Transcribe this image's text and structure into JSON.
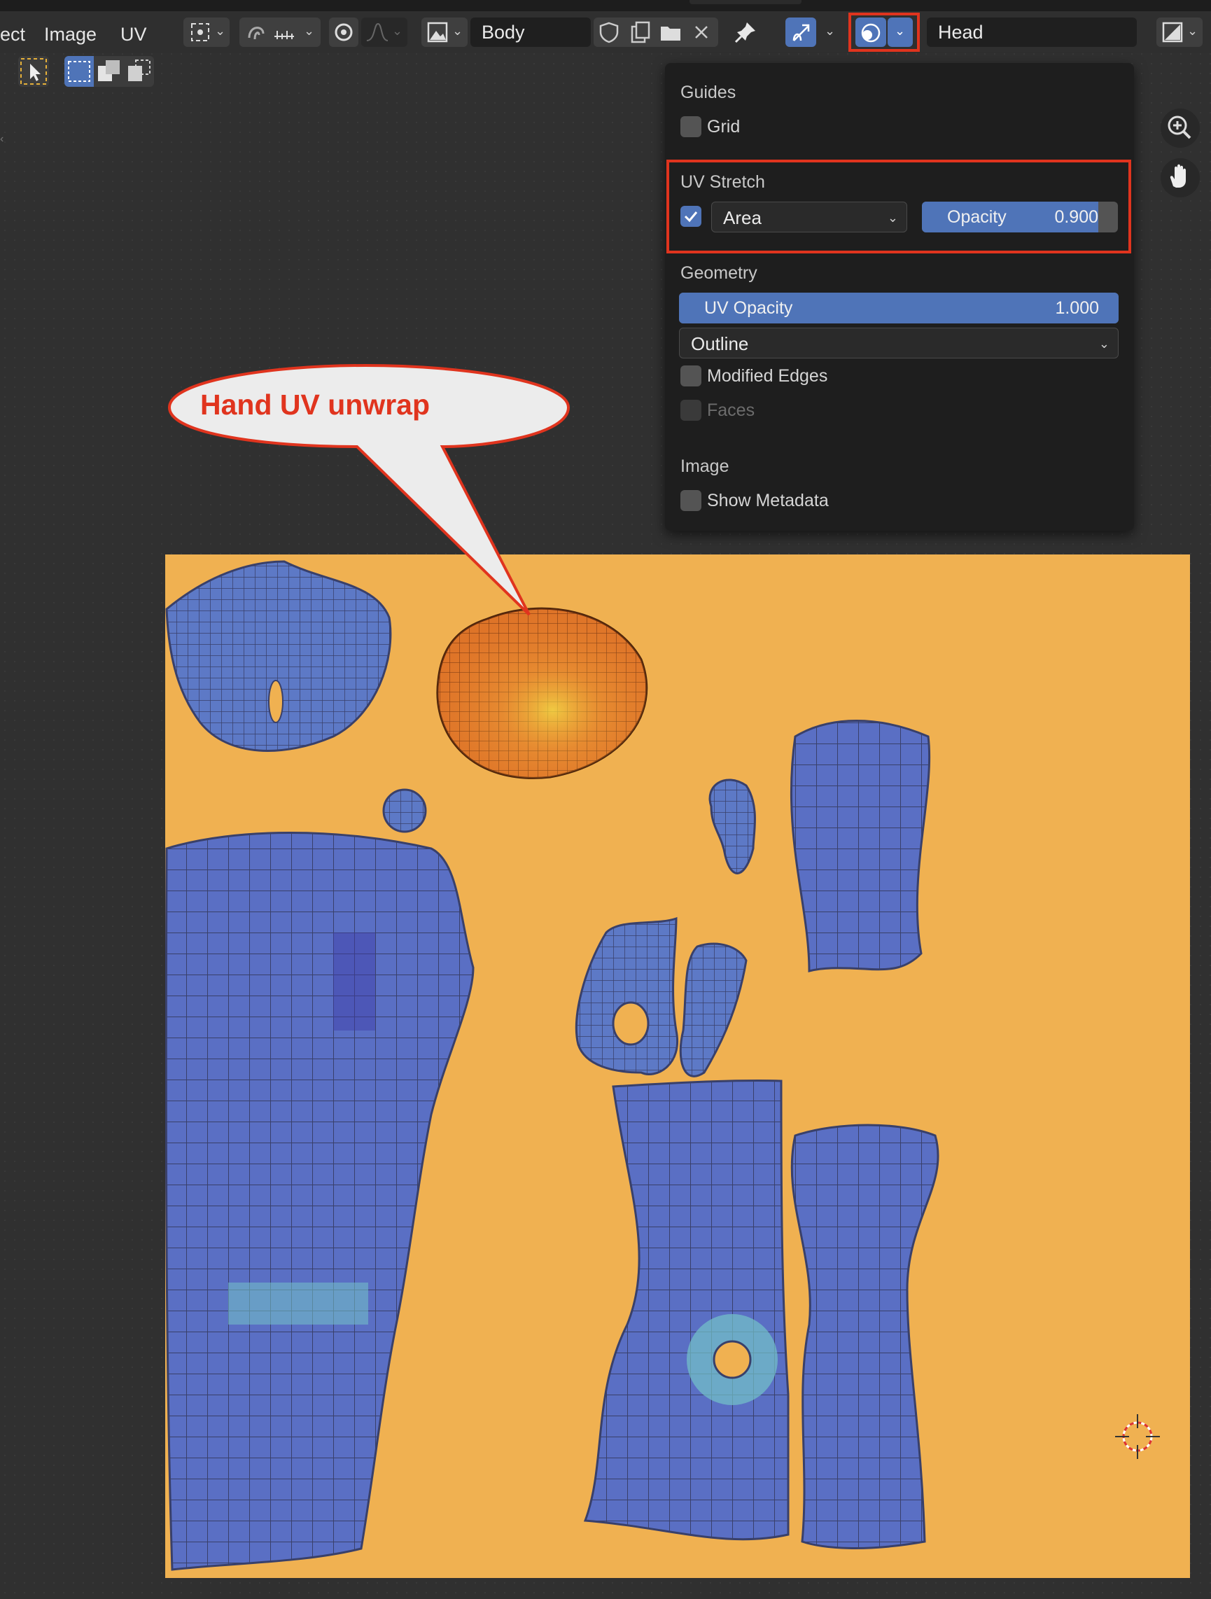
{
  "menubar": {
    "items": [
      "ect",
      "Image",
      "UV"
    ]
  },
  "toolbar": {
    "image_name": "Body",
    "uv_map_name": "Head"
  },
  "overlay_popup": {
    "guides": {
      "title": "Guides",
      "grid_label": "Grid",
      "grid_checked": false
    },
    "uv_stretch": {
      "title": "UV Stretch",
      "enabled": true,
      "mode": "Area",
      "opacity_label": "Opacity",
      "opacity_value": "0.900",
      "opacity_fraction": 0.9
    },
    "geometry": {
      "title": "Geometry",
      "uv_opacity_label": "UV Opacity",
      "uv_opacity_value": "1.000",
      "uv_opacity_fraction": 1.0,
      "edge_display": "Outline",
      "modified_edges_label": "Modified Edges",
      "modified_edges_checked": false,
      "faces_label": "Faces",
      "faces_checked": false
    },
    "image": {
      "title": "Image",
      "show_metadata_label": "Show Metadata",
      "show_metadata_checked": false
    }
  },
  "annotation": {
    "callout_text": "Hand UV unwrap",
    "color": "#e0341e"
  },
  "colors": {
    "accent_blue": "#4f74b8",
    "highlight_red": "#e0341e",
    "uv_background": "#f0b151",
    "island_blue": "#5a6fc4",
    "island_orange": "#e07a2a"
  },
  "icons": [
    "pivot-icon",
    "snap-icon",
    "proportional-edit-icon",
    "image-icon",
    "fake-user-shield-icon",
    "new-image-icon",
    "open-folder-icon",
    "close-icon",
    "pin-icon",
    "gizmo-icon",
    "overlay-icon",
    "uv-map-icon",
    "zoom-icon",
    "hand-pan-icon",
    "select-tweak-icon",
    "select-box-icon",
    "cursor-icon"
  ]
}
